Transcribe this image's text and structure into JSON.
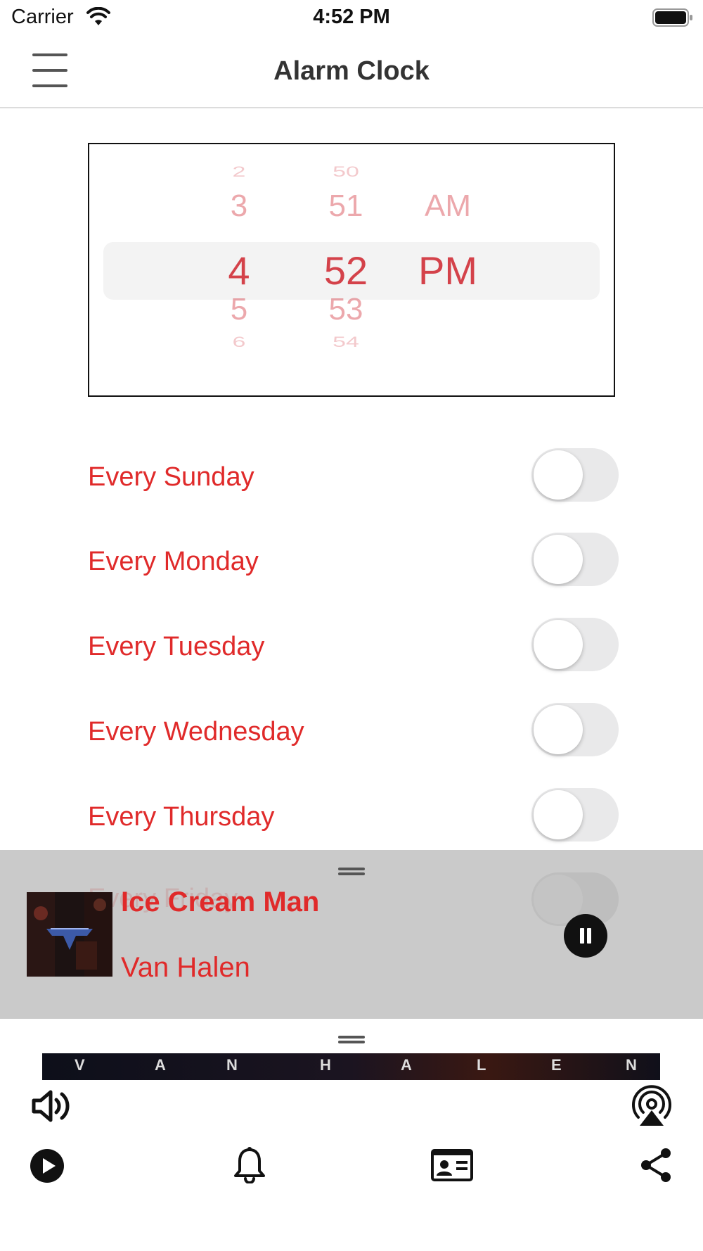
{
  "status_bar": {
    "carrier": "Carrier",
    "time": "4:52 PM"
  },
  "nav": {
    "title": "Alarm Clock"
  },
  "picker": {
    "hours": [
      "2",
      "3",
      "4",
      "5",
      "6"
    ],
    "minutes": [
      "50",
      "51",
      "52",
      "53",
      "54"
    ],
    "periods": [
      "AM",
      "PM"
    ],
    "selected": {
      "hour": "4",
      "minute": "52",
      "period": "PM"
    }
  },
  "days": [
    {
      "label": "Every Sunday",
      "on": false
    },
    {
      "label": "Every Monday",
      "on": false
    },
    {
      "label": "Every Tuesday",
      "on": false
    },
    {
      "label": "Every Wednesday",
      "on": false
    },
    {
      "label": "Every Thursday",
      "on": false
    },
    {
      "label": "Every Friday",
      "on": false
    }
  ],
  "player": {
    "title": "Ice Cream Man",
    "artist": "Van Halen",
    "state": "playing"
  },
  "banner": {
    "letters": [
      "V",
      "A",
      "N",
      "H",
      "A",
      "L",
      "E",
      "N"
    ]
  },
  "colors": {
    "accent": "#e02a2a",
    "picker_text": "#d4424a",
    "toggle_off": "#e9e9ea",
    "overlay": "#c8c8c8"
  },
  "icons": [
    "wifi-icon",
    "battery-icon",
    "menu-icon",
    "volume-icon",
    "airplay-icon",
    "play-icon",
    "bell-icon",
    "contact-card-icon",
    "share-icon"
  ]
}
